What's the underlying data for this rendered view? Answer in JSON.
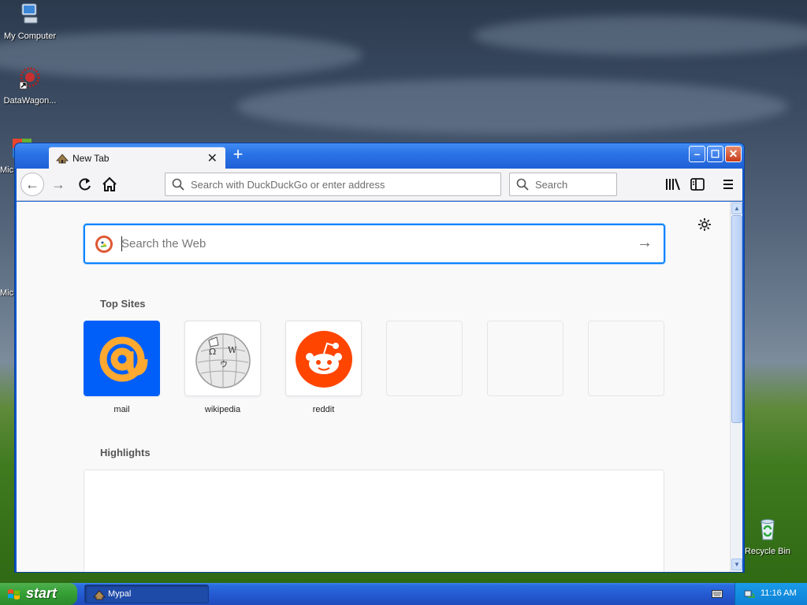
{
  "desktop": {
    "icons": [
      {
        "label": "My Computer"
      },
      {
        "label": "DataWagon..."
      },
      {
        "label": "Mic"
      },
      {
        "label": "Mic"
      },
      {
        "label": "Recycle Bin"
      }
    ]
  },
  "browser": {
    "tab_title": "New Tab",
    "url_placeholder": "Search with DuckDuckGo or enter address",
    "search_placeholder": "Search",
    "web_search_placeholder": "Search the Web",
    "top_sites_title": "Top Sites",
    "top_sites": [
      {
        "label": "mail"
      },
      {
        "label": "wikipedia"
      },
      {
        "label": "reddit"
      },
      {
        "label": ""
      },
      {
        "label": ""
      },
      {
        "label": ""
      }
    ],
    "highlights_title": "Highlights",
    "colors": {
      "accent": "#0a84ff",
      "titlebar": "#2a73e6",
      "reddit": "#ff4500",
      "mail": "#005ff9",
      "mail_at": "#ffa930"
    }
  },
  "taskbar": {
    "start_label": "start",
    "task_label": "Mypal",
    "clock": "11:16 AM"
  }
}
